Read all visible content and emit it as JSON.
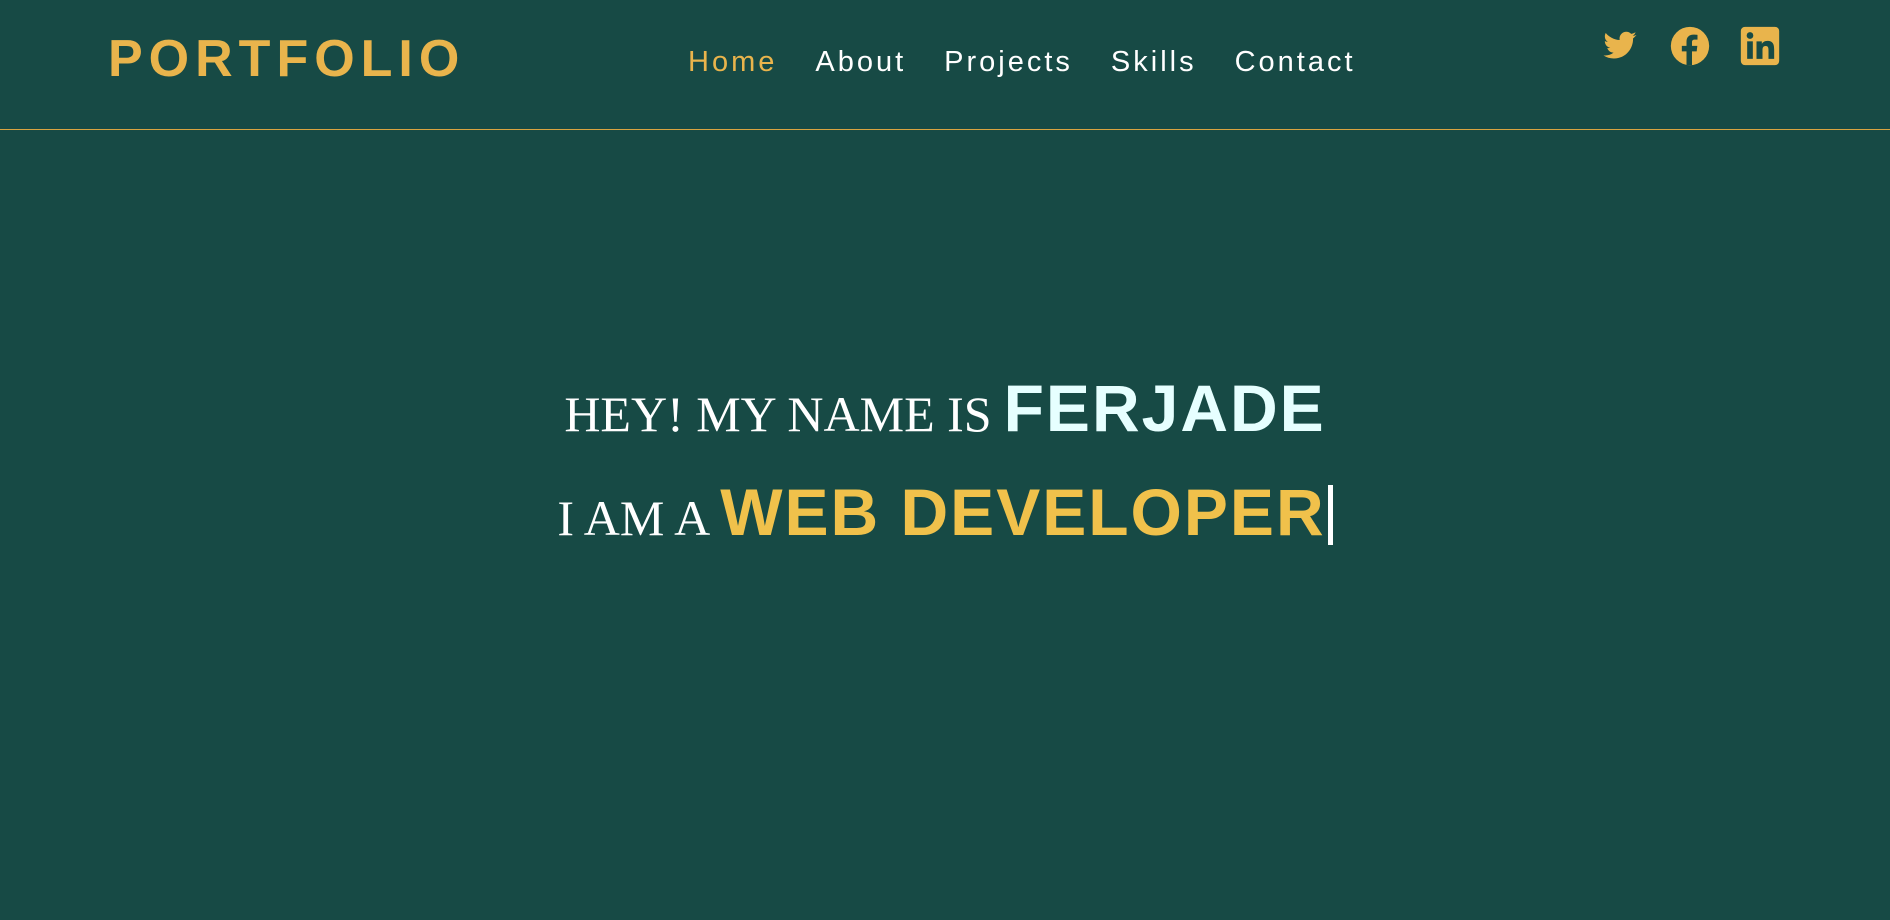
{
  "brand": {
    "logo": "PORTFOLIO"
  },
  "nav": {
    "items": [
      {
        "label": "Home",
        "active": true
      },
      {
        "label": "About",
        "active": false
      },
      {
        "label": "Projects",
        "active": false
      },
      {
        "label": "Skills",
        "active": false
      },
      {
        "label": "Contact",
        "active": false
      }
    ]
  },
  "socials": [
    {
      "icon": "twitter-icon"
    },
    {
      "icon": "facebook-icon"
    },
    {
      "icon": "linkedin-icon"
    }
  ],
  "hero": {
    "greeting": "HEY! MY NAME IS",
    "name": "FERJADE",
    "role_prefix": "I AM A",
    "role": "WEB DEVELOPER"
  },
  "colors": {
    "background": "#174a45",
    "accent": "#e9b44c",
    "role_text": "#f0c14b",
    "name_text": "#e6ffff",
    "nav_text": "#ffffff",
    "divider": "#d9a441"
  }
}
